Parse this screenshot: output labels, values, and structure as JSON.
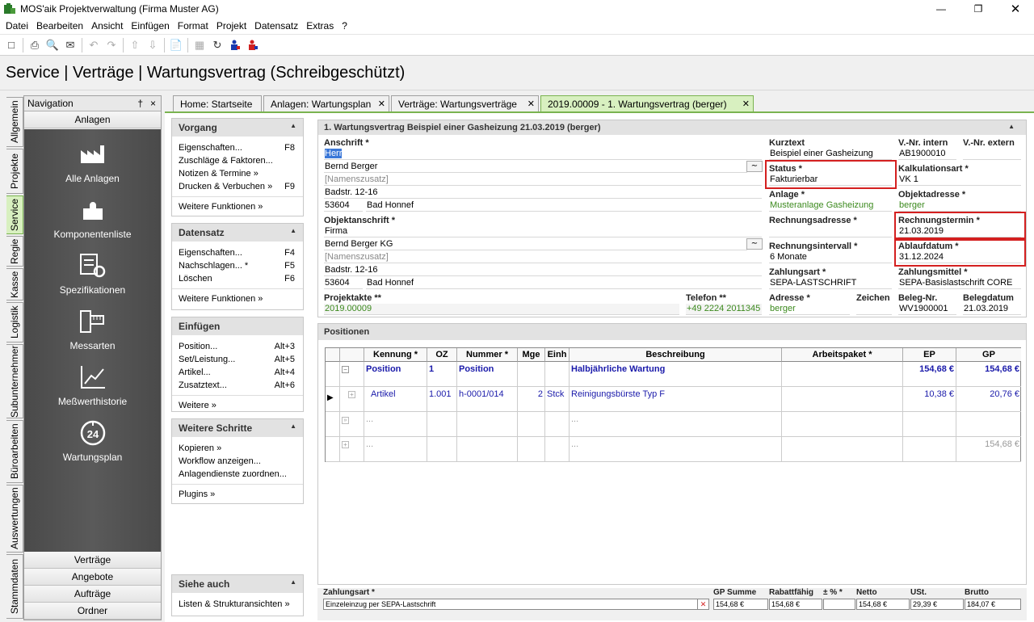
{
  "window": {
    "title": "MOS'aik Projektverwaltung (Firma Muster AG)"
  },
  "menu": [
    "Datei",
    "Bearbeiten",
    "Ansicht",
    "Einfügen",
    "Format",
    "Projekt",
    "Datensatz",
    "Extras",
    "?"
  ],
  "page_title": "Service | Verträge | Wartungsvertrag (Schreibgeschützt)",
  "vtabs": [
    {
      "label": "Allgemein"
    },
    {
      "label": "Projekte"
    },
    {
      "label": "Service"
    },
    {
      "label": "Regie"
    },
    {
      "label": "Kasse"
    },
    {
      "label": "Logistik"
    },
    {
      "label": "Subunternehmer"
    },
    {
      "label": "Büroarbeiten"
    },
    {
      "label": "Auswertungen"
    },
    {
      "label": "Stammdaten"
    }
  ],
  "nav": {
    "header": "Navigation",
    "pin": "†",
    "close": "×",
    "section": "Anlagen",
    "items": [
      {
        "label": "Alle Anlagen"
      },
      {
        "label": "Komponentenliste"
      },
      {
        "label": "Spezifikationen"
      },
      {
        "label": "Messarten"
      },
      {
        "label": "Meßwerthistorie"
      },
      {
        "label": "Wartungsplan"
      }
    ],
    "bottom": [
      "Verträge",
      "Angebote",
      "Aufträge",
      "Ordner"
    ]
  },
  "doc_tabs": [
    {
      "label": "Home: Startseite"
    },
    {
      "label": "Anlagen: Wartungsplan"
    },
    {
      "label": "Verträge: Wartungsverträge"
    },
    {
      "label": "2019.00009 - 1. Wartungsvertrag (berger)"
    }
  ],
  "side": {
    "vorgang": {
      "title": "Vorgang",
      "rows": [
        {
          "label": "Eigenschaften...",
          "key": "F8"
        },
        {
          "label": "Zuschläge & Faktoren...",
          "key": ""
        },
        {
          "label": "Notizen & Termine »",
          "key": ""
        },
        {
          "label": "Drucken & Verbuchen »",
          "key": "F9"
        }
      ],
      "more": "Weitere Funktionen »"
    },
    "datensatz": {
      "title": "Datensatz",
      "rows": [
        {
          "label": "Eigenschaften...",
          "key": "F4"
        },
        {
          "label": "Nachschlagen... *",
          "key": "F5"
        },
        {
          "label": "Löschen",
          "key": "F6"
        }
      ],
      "more": "Weitere Funktionen »"
    },
    "einfuegen": {
      "title": "Einfügen",
      "rows": [
        {
          "label": "Position...",
          "key": "Alt+3"
        },
        {
          "label": "Set/Leistung...",
          "key": "Alt+5"
        },
        {
          "label": "Artikel...",
          "key": "Alt+4"
        },
        {
          "label": "Zusatztext...",
          "key": "Alt+6"
        }
      ],
      "more": "Weitere »"
    },
    "schritte": {
      "title": "Weitere Schritte",
      "rows": [
        {
          "label": "Kopieren »",
          "key": ""
        },
        {
          "label": "Workflow anzeigen...",
          "key": ""
        },
        {
          "label": "Anlagendienste zuordnen...",
          "key": ""
        }
      ],
      "more": "Plugins »"
    },
    "siehe": {
      "title": "Siehe auch",
      "rows": [
        {
          "label": "Listen & Strukturansichten »",
          "key": ""
        }
      ]
    }
  },
  "form": {
    "title": "1. Wartungsvertrag Beispiel einer Gasheizung 21.03.2019 (berger)",
    "anschrift_label": "Anschrift *",
    "anschrift_anrede": "Herr",
    "anschrift_name": "Bernd Berger",
    "anschrift_zusatz": "[Namenszusatz]",
    "anschrift_strasse": "Badstr. 12-16",
    "anschrift_plz": "53604",
    "anschrift_ort": "Bad Honnef",
    "objektanschrift_label": "Objektanschrift *",
    "objekt_anrede": "Firma",
    "objekt_name": "Bernd Berger KG",
    "objekt_zusatz": "[Namenszusatz]",
    "objekt_strasse": "Badstr. 12-16",
    "objekt_plz": "53604",
    "objekt_ort": "Bad Honnef",
    "projektakte_label": "Projektakte **",
    "projektakte": "2019.00009",
    "telefon_label": "Telefon **",
    "telefon": "+49 2224 2011345",
    "kurztext_label": "Kurztext",
    "kurztext": "Beispiel einer Gasheizung",
    "vnr_intern_label": "V.-Nr. intern",
    "vnr_intern": "AB1900010",
    "vnr_extern_label": "V.-Nr. extern",
    "vnr_extern": "",
    "status_label": "Status *",
    "status": "Fakturierbar",
    "kalkulationsart_label": "Kalkulationsart *",
    "kalkulationsart": "VK 1",
    "anlage_label": "Anlage *",
    "anlage": "Musteranlage Gasheizung",
    "objektadresse_label": "Objektadresse *",
    "objektadresse": "berger",
    "rechnungsadresse_label": "Rechnungsadresse *",
    "rechnungsadresse": "",
    "rechnungstermin_label": "Rechnungstermin *",
    "rechnungstermin": "21.03.2019",
    "rechnungsintervall_label": "Rechnungsintervall *",
    "rechnungsintervall": "6 Monate",
    "ablaufdatum_label": "Ablaufdatum *",
    "ablaufdatum": "31.12.2024",
    "zahlungsart_label": "Zahlungsart *",
    "zahlungsart": "SEPA-LASTSCHRIFT",
    "zahlungsmittel_label": "Zahlungsmittel *",
    "zahlungsmittel": "SEPA-Basislastschrift CORE",
    "adresse_label": "Adresse *",
    "adresse": "berger",
    "zeichen_label": "Zeichen",
    "zeichen": "",
    "belegnr_label": "Beleg-Nr.",
    "belegnr": "WV1900001",
    "belegdatum_label": "Belegdatum",
    "belegdatum": "21.03.2019"
  },
  "positions": {
    "title": "Positionen",
    "columns": [
      "Kennung *",
      "OZ",
      "Nummer *",
      "Mge",
      "Einh",
      "Beschreibung",
      "Arbeitspaket *",
      "EP",
      "GP"
    ],
    "rows": [
      {
        "kennung": "Position",
        "oz": "1",
        "nummer": "Position",
        "mge": "",
        "einh": "",
        "beschreibung": "Halbjährliche Wartung",
        "arbeitspaket": "",
        "ep": "154,68 €",
        "gp": "154,68 €"
      },
      {
        "kennung": "Artikel",
        "oz": "1.001",
        "nummer": "h-0001/014",
        "mge": "2",
        "einh": "Stck",
        "beschreibung": "Reinigungsbürste Typ F",
        "arbeitspaket": "",
        "ep": "10,38 €",
        "gp": "20,76 €"
      },
      {
        "kennung": "...",
        "beschreibung": "..."
      },
      {
        "kennung": "...",
        "beschreibung": "...",
        "gp": "154,68 €"
      }
    ]
  },
  "footer": {
    "zahlungsart_label": "Zahlungsart *",
    "zahlungsart": "Einzeleinzug per SEPA-Lastschrift",
    "gp_summe_label": "GP Summe",
    "gp_summe": "154,68 €",
    "rabattfaehig_label": "Rabattfähig",
    "rabattfaehig": "154,68 €",
    "prozent_label": "± % *",
    "prozent": "",
    "netto_label": "Netto",
    "netto": "154,68 €",
    "ust_label": "USt.",
    "ust": "29,39 €",
    "brutto_label": "Brutto",
    "brutto": "184,07 €"
  },
  "colors": {
    "accent_green": "#7ab350",
    "highlight_red": "#d42020",
    "nav_dark": "#4a4a4a",
    "link_blue": "#1a1aaa"
  }
}
